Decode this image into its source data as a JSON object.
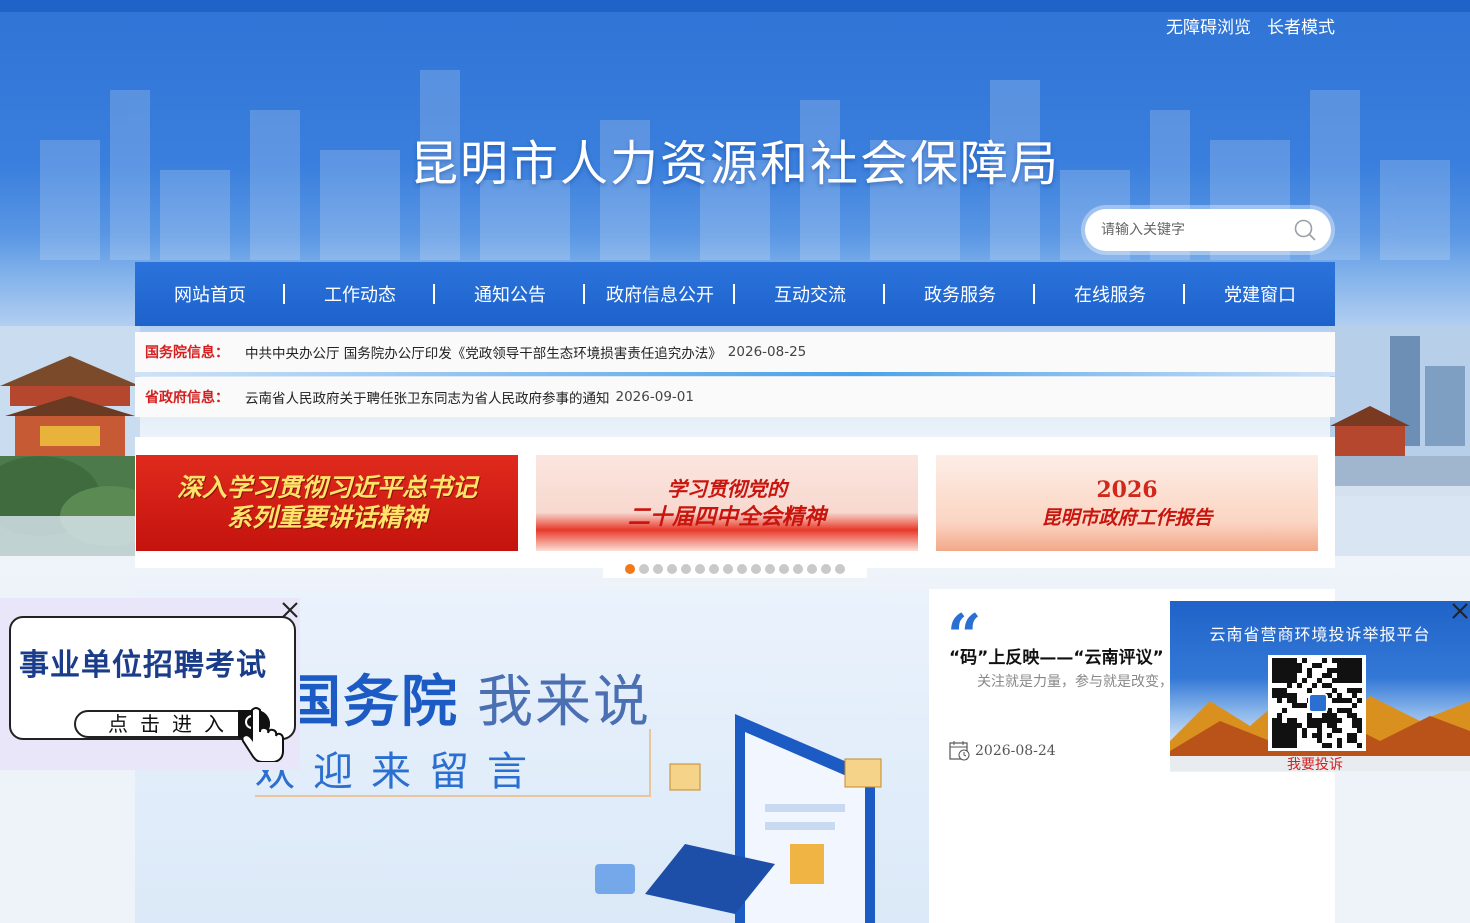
{
  "header": {
    "access_links": [
      "无障碍浏览",
      "长者模式"
    ],
    "site_title": "昆明市人力资源和社会保障局",
    "search": {
      "placeholder": "请输入关键字",
      "icon": "search-icon"
    }
  },
  "nav": {
    "items": [
      "网站首页",
      "工作动态",
      "通知公告",
      "政府信息公开",
      "互动交流",
      "政务服务",
      "在线服务",
      "党建窗口"
    ]
  },
  "notices": [
    {
      "label": "国务院信息：",
      "text": "中共中央办公厅 国务院办公厅印发《党政领导干部生态环境损害责任追究办法》",
      "date": "2026-08-25"
    },
    {
      "label": "省政府信息：",
      "text": "云南省人民政府关于聘任张卫东同志为省人民政府参事的通知",
      "date": "2026-09-01"
    }
  ],
  "banners": {
    "b1": {
      "line1": "深入学习贯彻习近平总书记",
      "line2": "系列重要讲话精神"
    },
    "b2": {
      "line1": "学习贯彻党的",
      "line2": "二十届四中全会精神"
    },
    "b3": {
      "year": "2026",
      "title": "昆明市政府工作报告"
    },
    "pager": {
      "total": 16,
      "active": 1
    }
  },
  "feature": {
    "headline_bold": "国务院",
    "headline_light": "我来说",
    "subline": "欢迎来留言"
  },
  "quote_panel": {
    "title": "“码”上反映——“云南评议”",
    "subtitle": "关注就是力量，参与就是改变，",
    "date": "2026-08-24",
    "icon": "calendar-icon"
  },
  "float_left": {
    "title": "事业单位招聘考试",
    "button": "点击进入"
  },
  "float_right": {
    "title": "云南省营商环境投诉举报平台",
    "link": "我要投诉"
  },
  "colors": {
    "brand_blue": "#1f63c9",
    "notice_red": "#d42020",
    "pager_active": "#f07a1a"
  }
}
